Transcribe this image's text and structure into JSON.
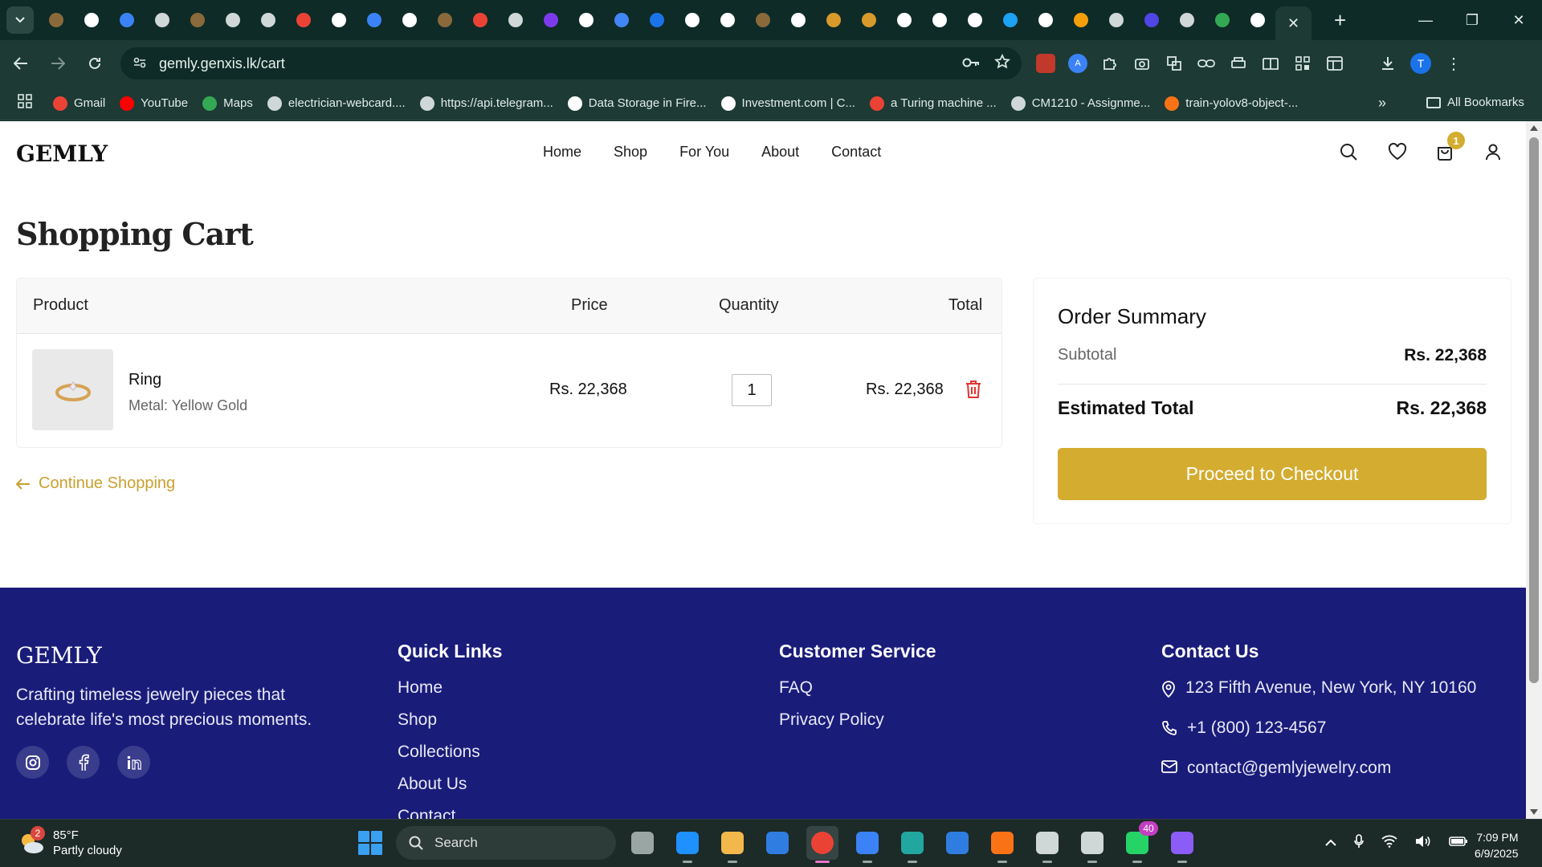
{
  "browser": {
    "url": "gemly.genxis.lk/cart",
    "tab_icon_colors": [
      "#8a6a3a",
      "#ffffff",
      "#3b82f6",
      "#cfd8d6",
      "#8a6a3a",
      "#cfd8d6",
      "#cfd8d6",
      "#ea4335",
      "#ffffff",
      "#3b82f6",
      "#ffffff",
      "#8a6a3a",
      "#ea4335",
      "#cfd8d6",
      "#7c3aed",
      "#ffffff",
      "#4285f4",
      "#1a73e8",
      "#ffffff",
      "#ffffff",
      "#8a6a3a",
      "#ffffff",
      "#d89b2b",
      "#d89b2b",
      "#ffffff",
      "#ffffff",
      "#ffffff",
      "#1da1f2",
      "#ffffff",
      "#f59e0b",
      "#cfd8d6",
      "#4f46e5",
      "#cfd8d6",
      "#34a853",
      "#ffffff"
    ],
    "bookmarks": [
      {
        "label": "Gmail",
        "color": "#ea4335"
      },
      {
        "label": "YouTube",
        "color": "#ff0000"
      },
      {
        "label": "Maps",
        "color": "#34a853"
      },
      {
        "label": "electrician-webcard....",
        "color": "#cfd8d6"
      },
      {
        "label": "https://api.telegram...",
        "color": "#cfd8d6"
      },
      {
        "label": "Data Storage in Fire...",
        "color": "#ffffff"
      },
      {
        "label": "Investment.com | C...",
        "color": "#ffffff"
      },
      {
        "label": "a Turing machine ...",
        "color": "#ea4335"
      },
      {
        "label": "CM1210 - Assignme...",
        "color": "#cfd8d6"
      },
      {
        "label": "train-yolov8-object-...",
        "color": "#f97316"
      }
    ],
    "all_bookmarks": "All Bookmarks",
    "profile_initial": "T"
  },
  "site": {
    "logo": "GEMLY",
    "nav": [
      "Home",
      "Shop",
      "For You",
      "About",
      "Contact"
    ],
    "cart_count": "1"
  },
  "cart": {
    "title": "Shopping Cart",
    "headers": {
      "product": "Product",
      "price": "Price",
      "quantity": "Quantity",
      "total": "Total"
    },
    "items": [
      {
        "name": "Ring",
        "meta": "Metal: Yellow Gold",
        "price": "Rs. 22,368",
        "quantity": "1",
        "total": "Rs. 22,368"
      }
    ],
    "continue": "Continue Shopping"
  },
  "summary": {
    "title": "Order Summary",
    "subtotal_label": "Subtotal",
    "subtotal_value": "Rs. 22,368",
    "total_label": "Estimated Total",
    "total_value": "Rs. 22,368",
    "checkout": "Proceed to Checkout"
  },
  "footer": {
    "logo": "GEMLY",
    "tagline": "Crafting timeless jewelry pieces that celebrate life's most precious moments.",
    "quick_links_title": "Quick Links",
    "quick_links": [
      "Home",
      "Shop",
      "Collections",
      "About Us",
      "Contact"
    ],
    "service_title": "Customer Service",
    "service_links": [
      "FAQ",
      "Privacy Policy"
    ],
    "contact_title": "Contact Us",
    "address": "123 Fifth Avenue, New York, NY 10160",
    "phone": "+1 (800) 123-4567",
    "email": "contact@gemlyjewelry.com"
  },
  "taskbar": {
    "weather_temp": "85°F",
    "weather_desc": "Partly cloudy",
    "weather_badge": "2",
    "search": "Search",
    "whatsapp_badge": "40",
    "time": "7:09 PM",
    "date": "6/9/2025",
    "app_colors": [
      "#9aa6a4",
      "#1e90ff",
      "#f2b84b",
      "#2f7de1",
      "#ea4335",
      "#3b82f6",
      "#22a6a0",
      "#2f7de1",
      "#f97316",
      "#cfd8d6",
      "#cfd8d6",
      "#25d366",
      "#8b5cf6"
    ]
  }
}
